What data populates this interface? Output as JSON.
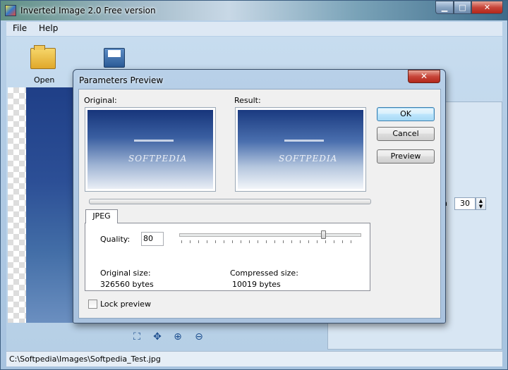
{
  "main_window": {
    "title": "Inverted Image 2.0 Free version",
    "caption_buttons": {
      "minimize": "▁",
      "maximize": "□",
      "close": "✕"
    }
  },
  "menu": {
    "file": "File",
    "help": "Help"
  },
  "toolbar": {
    "open_label": "Open"
  },
  "side_panel": {
    "spin_label": "h",
    "spin_value": "30"
  },
  "statusbar": {
    "path": "C:\\Softpedia\\Images\\Softpedia_Test.jpg"
  },
  "dialog": {
    "title": "Parameters Preview",
    "close_glyph": "✕",
    "original_label": "Original:",
    "result_label": "Result:",
    "image_logo_text": "SOFTPEDIA",
    "buttons": {
      "ok": "OK",
      "cancel": "Cancel",
      "preview": "Preview"
    },
    "tab_jpeg": "JPEG",
    "quality_label": "Quality:",
    "quality_value": "80",
    "quality_slider_value": 80,
    "original_size_label": "Original size:",
    "original_size_value": "326560 bytes",
    "compressed_size_label": "Compressed size:",
    "compressed_size_value": "10019 bytes",
    "lock_preview_label": "Lock preview",
    "lock_preview_checked": false
  },
  "colors": {
    "dialog_close": "#c7463a",
    "ok_focus": "#3c7fb1"
  }
}
